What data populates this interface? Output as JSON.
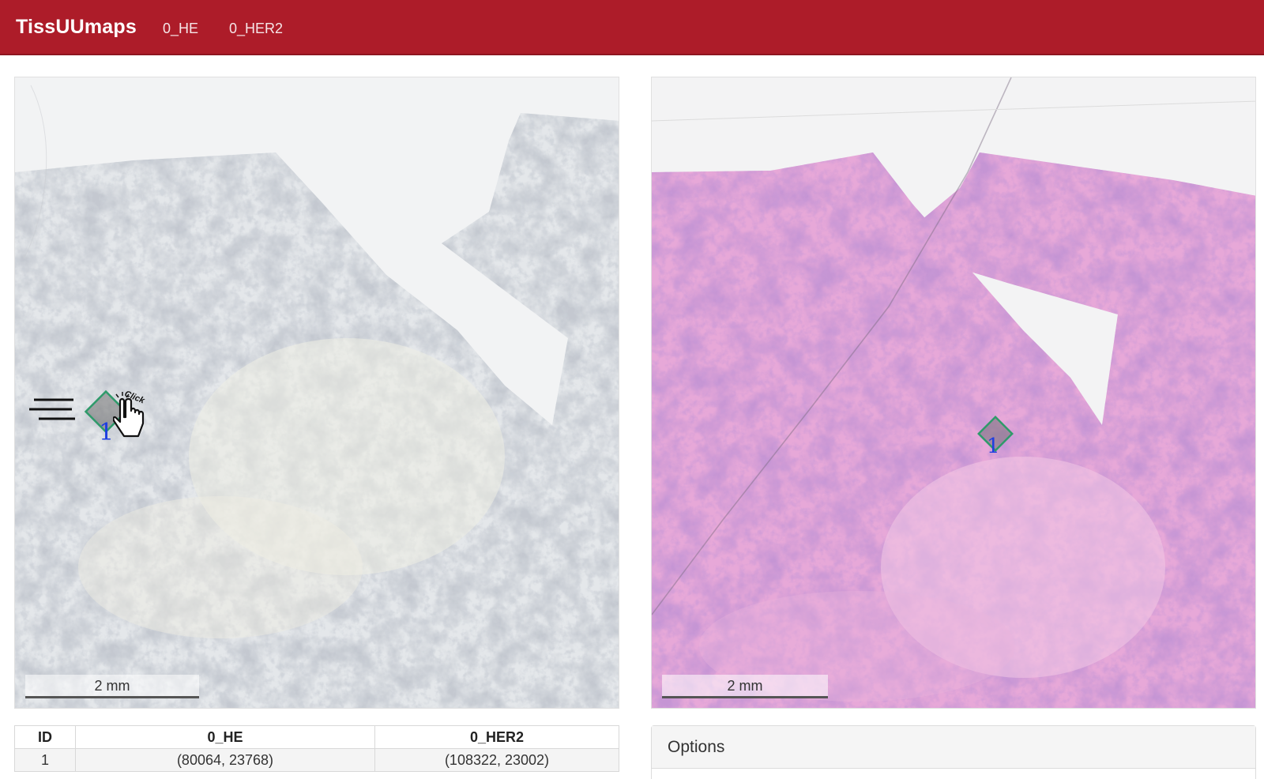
{
  "navbar": {
    "brand": "TissUUmaps",
    "links": [
      "0_HE",
      "0_HER2"
    ]
  },
  "viewers": {
    "left": {
      "scale_label": "2 mm",
      "landmark_label": "1"
    },
    "right": {
      "scale_label": "2 mm",
      "landmark_label": "1"
    }
  },
  "cursor": {
    "hint": "Click"
  },
  "table": {
    "headers": [
      "ID",
      "0_HE",
      "0_HER2"
    ],
    "rows": [
      [
        "1",
        "(80064, 23768)",
        "(108322, 23002)"
      ]
    ]
  },
  "options": {
    "title": "Options"
  },
  "colors": {
    "navbar": "#ad1c29",
    "landmark_outline": "#2e9a6a",
    "landmark_label": "#1f3fe0"
  }
}
